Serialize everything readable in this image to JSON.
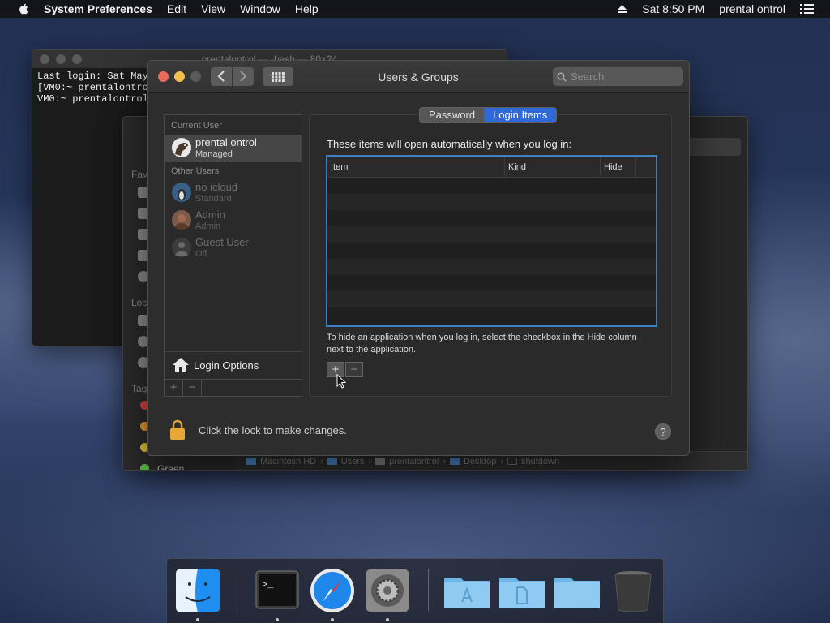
{
  "menubar": {
    "app_name": "System Preferences",
    "items": [
      "Edit",
      "View",
      "Window",
      "Help"
    ],
    "clock": "Sat 8:50 PM",
    "user": "prental ontrol"
  },
  "terminal": {
    "title": "prentalontrol — -bash — 80×24",
    "lines": [
      "Last login: Sat May",
      "[VM0:~ prentalontrol$",
      "VM0:~ prentalontrol$"
    ]
  },
  "finder": {
    "sidebar_sections": [
      "Favorites",
      "Locations",
      "Tags"
    ],
    "tag_green_label": "Green",
    "path": [
      "Macintosh HD",
      "Users",
      "prentalontrol",
      "Desktop",
      "shutdown"
    ]
  },
  "prefs": {
    "title": "Users & Groups",
    "search_placeholder": "Search",
    "current_user_header": "Current User",
    "other_users_header": "Other Users",
    "users": [
      {
        "name": "prental ontrol",
        "role": "Managed"
      },
      {
        "name": "no icloud",
        "role": "Standard"
      },
      {
        "name": "Admin",
        "role": "Admin"
      },
      {
        "name": "Guest User",
        "role": "Off"
      }
    ],
    "login_options_label": "Login Options",
    "tabs": [
      "Password",
      "Login Items"
    ],
    "active_tab": "Login Items",
    "items_label": "These items will open automatically when you log in:",
    "table_headers": [
      "Item",
      "Kind",
      "Hide"
    ],
    "help_text": "To hide an application when you log in, select the checkbox in the Hide column next to the application.",
    "add_label": "+",
    "remove_label": "−",
    "lock_text": "Click the lock to make changes.",
    "help_label": "?"
  },
  "dock": {
    "apps": [
      "Finder",
      "Terminal",
      "Safari",
      "System Preferences",
      "Applications",
      "Documents",
      "Downloads",
      "Trash"
    ]
  },
  "colors": {
    "accent": "#2f68d8",
    "table_focus": "#3d7fc4"
  }
}
